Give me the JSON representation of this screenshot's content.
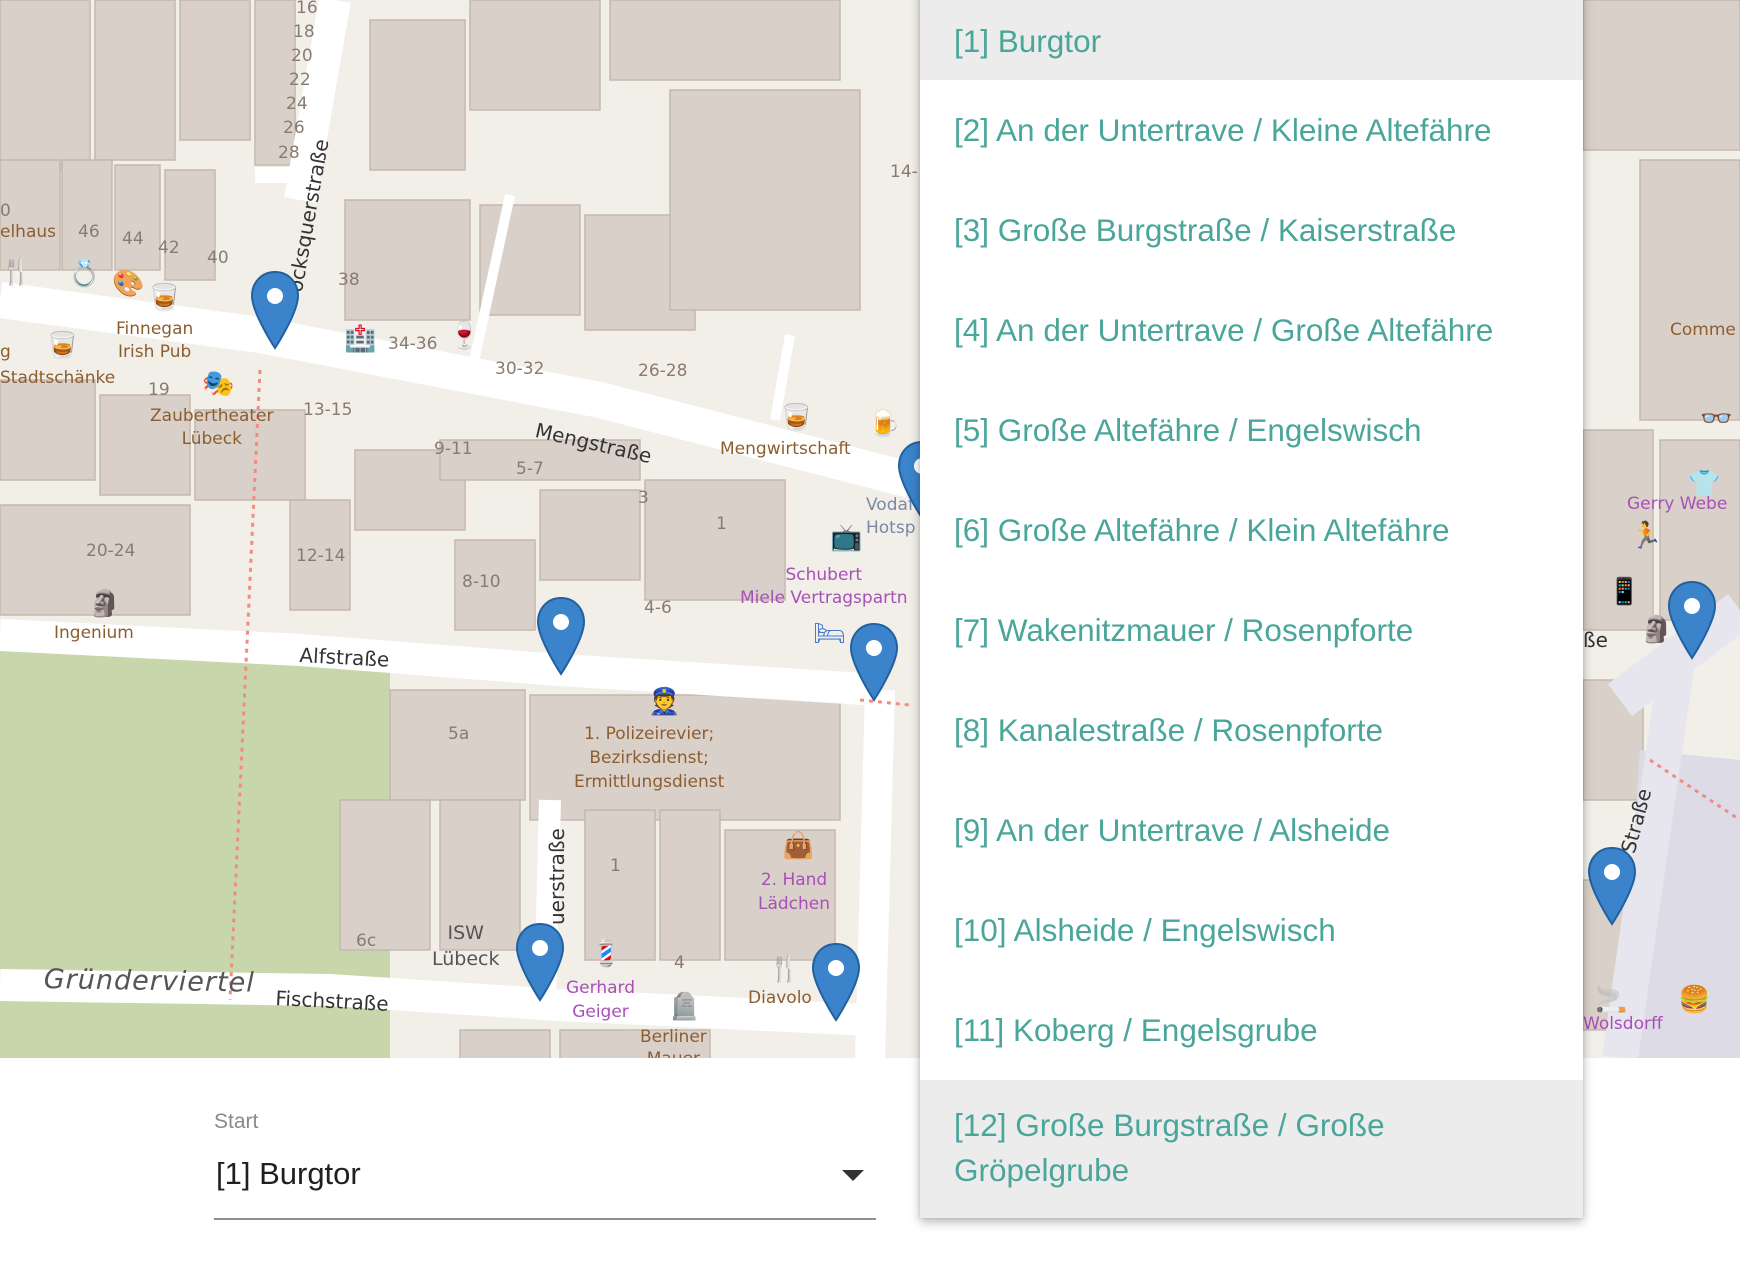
{
  "map": {
    "street_names": {
      "mengstrasse": "Mengstraße",
      "alfstrasse": "Alfstraße",
      "fischstrasse": "Fischstraße",
      "backsquerstrasse": "ocksquerstraße",
      "querstrasse_lower": "uerstraße",
      "strasse_right": "Straße",
      "be_right": "ße",
      "district": "Gründerviertel"
    },
    "house_numbers": {
      "n16": "16",
      "n18": "18",
      "n20": "20",
      "n22": "22",
      "n24": "24",
      "n26": "26",
      "n28": "28",
      "n46": "46",
      "n44": "44",
      "n42": "42",
      "n40": "40",
      "n38": "38",
      "n34_36": "34-36",
      "n30_32": "30-32",
      "n26_28": "26-28",
      "n19": "19",
      "n13_15": "13-15",
      "n9_11": "9-11",
      "n5_7": "5-7",
      "n3": "3",
      "n1": "1",
      "n20_24": "20-24",
      "n12_14": "12-14",
      "n8_10": "8-10",
      "n4_6": "4-6",
      "n5a": "5a",
      "n6c": "6c",
      "n1b": "1",
      "n4": "4",
      "n14": "14-",
      "n0": "0"
    },
    "poi_names": {
      "elhaus": "elhaus",
      "finnegan": "Finnegan\nIrish Pub",
      "stadtschanke": "Stadtschänke",
      "g": "g",
      "zaubertheater": "Zaubertheater\nLübeck",
      "mengwirtschaft": "Mengwirtschaft",
      "vodafone": "Vodaf\nHotsp",
      "schubert": "Schubert\nMiele Vertragspartn",
      "ingenium": "Ingenium",
      "polizei": "1. Polizeirevier;\nBezirksdienst;\nErmittlungsdienst",
      "hand": "2. Hand\nLädchen",
      "isw": "ISW\nLübeck",
      "gerhard": "Gerhard\nGeiger",
      "diavolo": "Diavolo",
      "berliner": "Berliner\nMauer",
      "comme": "Comme",
      "gerry": "Gerry Webe",
      "wolsdorff": "Wolsdorff"
    },
    "markers": [
      {
        "id": "m1",
        "name": "marker"
      },
      {
        "id": "m2",
        "name": "marker"
      },
      {
        "id": "m3",
        "name": "marker"
      },
      {
        "id": "m4",
        "name": "marker"
      },
      {
        "id": "m5",
        "name": "marker"
      },
      {
        "id": "m6",
        "name": "marker"
      },
      {
        "id": "m7",
        "name": "marker"
      },
      {
        "id": "m8",
        "name": "marker"
      }
    ],
    "marker_color": "#3b84cc"
  },
  "form": {
    "start_label": "Start",
    "start_value": "[1] Burgtor",
    "arrow_icon": "dropdown-arrow-icon"
  },
  "dropdown": {
    "options": [
      {
        "label": "[1] Burgtor",
        "highlighted": true
      },
      {
        "label": "[2] An der Untertrave / Kleine Altefähre",
        "highlighted": false
      },
      {
        "label": "[3] Große Burgstraße / Kaiserstraße",
        "highlighted": false
      },
      {
        "label": "[4] An der Untertrave / Große Altefähre",
        "highlighted": false
      },
      {
        "label": "[5] Große Altefähre / Engelswisch",
        "highlighted": false
      },
      {
        "label": "[6] Große Altefähre / Klein Altefähre",
        "highlighted": false
      },
      {
        "label": "[7] Wakenitzmauer / Rosenpforte",
        "highlighted": false
      },
      {
        "label": "[8] Kanalestraße / Rosenpforte",
        "highlighted": false
      },
      {
        "label": "[9] An der Untertrave / Alsheide",
        "highlighted": false
      },
      {
        "label": "[10] Alsheide / Engelswisch",
        "highlighted": false
      },
      {
        "label": "[11] Koberg / Engelsgrube",
        "highlighted": false
      },
      {
        "label": "[12] Große Burgstraße / Große Gröpelgrube",
        "highlighted": true
      }
    ],
    "accent_color": "#4aa59a",
    "highlight_color": "#ececec"
  }
}
